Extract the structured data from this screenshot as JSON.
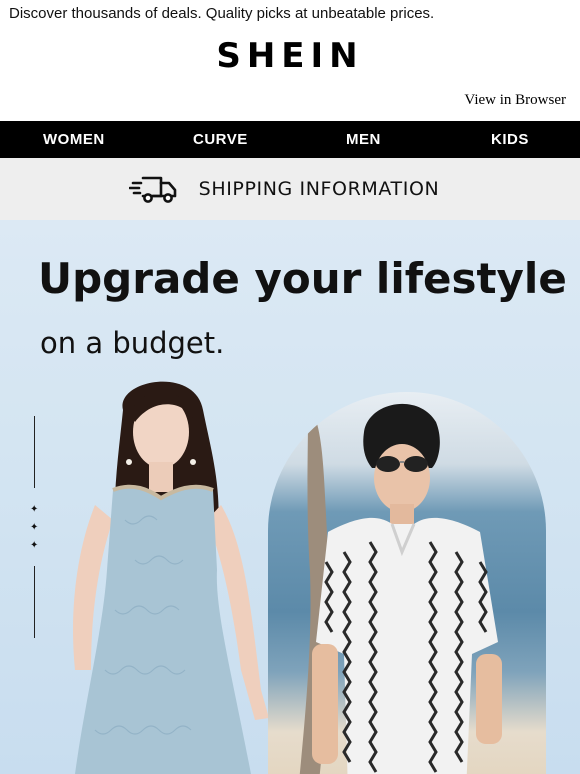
{
  "preheader": "Discover thousands of deals. Quality picks at unbeatable prices.",
  "brand": "SHEIN",
  "view_in_browser": "View in Browser",
  "nav": {
    "items": [
      {
        "label": "WOMEN"
      },
      {
        "label": "CURVE"
      },
      {
        "label": "MEN"
      },
      {
        "label": "KIDS"
      }
    ]
  },
  "shipping": {
    "icon": "delivery-truck-icon",
    "label": "SHIPPING INFORMATION"
  },
  "hero": {
    "headline": "Upgrade your lifestyle",
    "subline": "on a budget."
  },
  "colors": {
    "nav_bg": "#000000",
    "shipping_bg": "#eeeeee",
    "hero_bg": "#d4e5f2"
  }
}
